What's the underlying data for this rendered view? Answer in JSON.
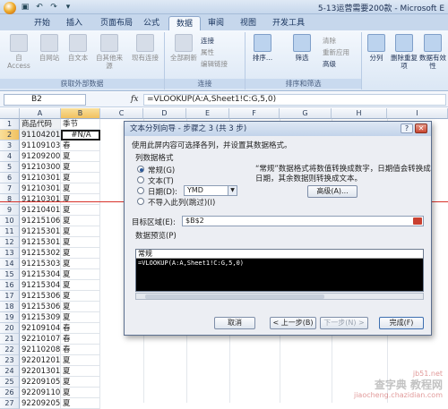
{
  "window": {
    "title": "5-13运营需要200款 - Microsoft E"
  },
  "ribbon": {
    "tabs": [
      "开始",
      "插入",
      "页面布局",
      "公式",
      "数据",
      "审阅",
      "视图",
      "开发工具"
    ],
    "active_tab": "数据",
    "groups": {
      "external": {
        "label": "获取外部数据",
        "items": [
          "自 Access",
          "自网站",
          "自文本",
          "自其他来源",
          "现有连接"
        ]
      },
      "connections": {
        "label": "连接",
        "refresh": "全部刷新",
        "small": [
          "连接",
          "属性",
          "编辑链接"
        ]
      },
      "sort": {
        "label": "排序和筛选",
        "sort_az": "排序...",
        "filter": "筛选",
        "small": [
          "清除",
          "重新应用",
          "高级"
        ]
      },
      "tools": {
        "split": "分列",
        "dedupe": "删除重复项",
        "valid": "数据有效性"
      }
    }
  },
  "formula_bar": {
    "name_box": "B2",
    "fx": "fx",
    "formula": "=VLOOKUP(A:A,Sheet1!C:G,5,0)"
  },
  "grid": {
    "columns": [
      "A",
      "B",
      "C",
      "D",
      "E",
      "F",
      "G",
      "H",
      "I"
    ],
    "header_row": {
      "a": "商品代码",
      "b": "季节"
    },
    "rows": [
      {
        "n": "2",
        "a": "911042015",
        "b": "#N/A"
      },
      {
        "n": "3",
        "a": "911091038",
        "b": "春"
      },
      {
        "n": "4",
        "a": "912092001",
        "b": "夏"
      },
      {
        "n": "5",
        "a": "912103009",
        "b": "夏"
      },
      {
        "n": "6",
        "a": "912103010",
        "b": "夏"
      },
      {
        "n": "7",
        "a": "912103011",
        "b": "夏"
      },
      {
        "n": "8",
        "a": "912103017",
        "b": "夏"
      },
      {
        "n": "9",
        "a": "912104015",
        "b": "夏"
      },
      {
        "n": "10",
        "a": "912151064",
        "b": "夏"
      },
      {
        "n": "11",
        "a": "912153018",
        "b": "夏"
      },
      {
        "n": "12",
        "a": "912153019",
        "b": "夏"
      },
      {
        "n": "13",
        "a": "912153025",
        "b": "夏"
      },
      {
        "n": "14",
        "a": "912153037",
        "b": "夏"
      },
      {
        "n": "15",
        "a": "912153046",
        "b": "夏"
      },
      {
        "n": "16",
        "a": "912153048",
        "b": "夏"
      },
      {
        "n": "17",
        "a": "912153063",
        "b": "夏"
      },
      {
        "n": "18",
        "a": "912153066",
        "b": "夏"
      },
      {
        "n": "19",
        "a": "912153095",
        "b": "夏"
      },
      {
        "n": "20",
        "a": "921091045",
        "b": "春"
      },
      {
        "n": "21",
        "a": "922101074",
        "b": "春"
      },
      {
        "n": "22",
        "a": "921102081",
        "b": "春"
      },
      {
        "n": "23",
        "a": "922012016",
        "b": "夏"
      },
      {
        "n": "24",
        "a": "922013017",
        "b": "夏"
      },
      {
        "n": "25",
        "a": "922091058",
        "b": "夏"
      },
      {
        "n": "26",
        "a": "922091107",
        "b": "夏"
      },
      {
        "n": "27",
        "a": "922092051",
        "b": "夏"
      }
    ]
  },
  "dialog": {
    "title": "文本分列向导 - 步骤之 3 (共 3 步)",
    "intro": "使用此屏内容可选择各列，并设置其数据格式。",
    "format_group": "列数据格式",
    "options": [
      "常规(G)",
      "文本(T)",
      "日期(D):",
      "不导入此列(跳过)(I)"
    ],
    "date_format": "YMD",
    "note_line1": "“常规”数据格式将数值转换成数字，日期值会转换成",
    "note_line2": "日期，其余数据则转换成文本。",
    "advanced": "高级(A)...",
    "target_label": "目标区域(E):",
    "target_value": "$B$2",
    "preview_label": "数据预览(P)",
    "preview_header": "常规",
    "preview_row": "=VLOOKUP(A:A,Sheet1!C:G,5,0)",
    "buttons": {
      "cancel": "取消",
      "back": "< 上一步(B)",
      "next": "下一步(N) >",
      "finish": "完成(F)"
    }
  },
  "watermark": {
    "text": "查字典 教程网",
    "url": "jiaocheng.chazidian.com",
    "site": "jb51.net"
  }
}
